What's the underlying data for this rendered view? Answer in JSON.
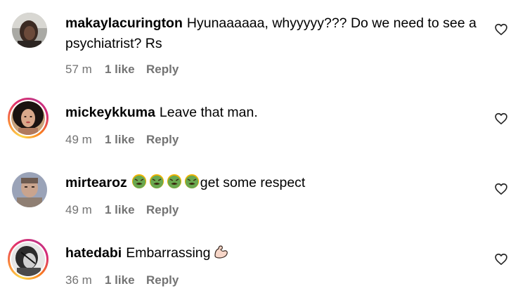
{
  "comments": [
    {
      "username": "makaylacurington",
      "text": "Hyunaaaaaa, whyyyyy??? Do we need to see a psychiatrist? Rs",
      "time": "57 m",
      "likes": "1 like",
      "reply": "Reply",
      "has_story_ring": false
    },
    {
      "username": "mickeykkuma",
      "text": "Leave that man.",
      "time": "49 m",
      "likes": "1 like",
      "reply": "Reply",
      "has_story_ring": true
    },
    {
      "username": "mirtearoz",
      "text": "get some respect",
      "emojis": [
        "nauseated-face",
        "nauseated-face",
        "nauseated-face",
        "nauseated-face"
      ],
      "time": "49 m",
      "likes": "1 like",
      "reply": "Reply",
      "has_story_ring": false
    },
    {
      "username": "hatedabi",
      "text": "Embarrassing",
      "emojis": [
        "flexed-biceps"
      ],
      "time": "36 m",
      "likes": "1 like",
      "reply": "Reply",
      "has_story_ring": true
    }
  ],
  "colors": {
    "meta_text": "#737373",
    "emoji_green": "#6aa84f",
    "emoji_yellow": "#f4b400"
  },
  "icons": {
    "like": "heart-outline-icon"
  }
}
